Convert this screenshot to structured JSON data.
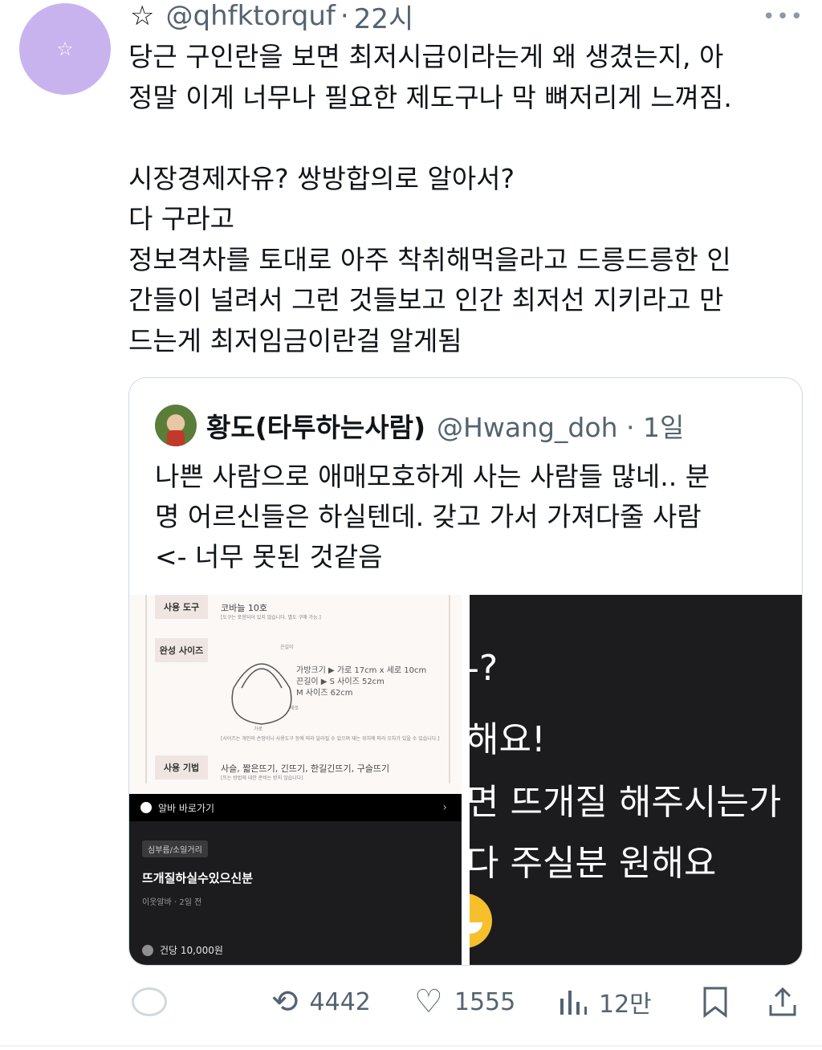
{
  "tweet": {
    "star": "☆",
    "handle": "@qhfktorquf",
    "time": "22시",
    "more": "•••",
    "text": "당근 구인란을 보면 최저시급이라는게 왜 생겼는지, 아\n정말 이게 너무나 필요한 제도구나 막 뼈저리게 느껴짐.\n\n시장경제자유? 쌍방합의로 알아서?\n다 구라고\n정보격차를 토대로 아주 착취해먹을라고 드릉드릉한 인\n간들이 널려서 그런 것들보고 인간 최저선 지키라고 만\n드는게 최저임금이란걸 알게됨"
  },
  "quote": {
    "name": "황도(타투하는사람)",
    "handle": "@Hwang_doh",
    "time": "1일",
    "text": "나쁜 사람으로 애매모호하게 사는 사람들 많네.. 분\n명 어르신들은 하실텐데. 갖고 가서 가져다줄 사람\n<- 너무 못된 것같음",
    "media_left": {
      "tool_label": "사용 도구",
      "tool_value": "코바늘 10호",
      "tool_note": "[도구는 포함되어 있지 않습니다. 별도 구매 가능.]",
      "size_label": "완성 사이즈",
      "strap_tag": "끈길이",
      "spec": "가방크기 ▶ 가로 17cm x 세로 10cm\n끈길이 ▶ S 사이즈 52cm\nM 사이즈 62cm",
      "width_tag": "가로",
      "height_tag": "세로",
      "disclaimer": "[사이즈는 개인의 손땀이나 사용도구 등에 따라 달라질 수 있으며 재는 위치에 따라 오차가 있을 수 있습니다.]",
      "method_label": "사용 기법",
      "method_value": "사슬, 짧은뜨기, 긴뜨기, 한길긴뜨기, 구슬뜨기",
      "method_note": "[뜨는 방법에 대한 준비는 받지 않습니다]",
      "alba_link": "알바 바로가기",
      "category": "심부름/소일거리",
      "job_title": "뜨개질하실수있으신분",
      "job_meta": "이웃알바 · 2일 전",
      "pay": "건당 10,000원"
    },
    "media_right": {
      "line1": "-?",
      "line2": "해요!",
      "line3": "면 뜨개질 해주시는가",
      "line4": "다 주실분 원해요"
    }
  },
  "actions": {
    "retweets": "4442",
    "likes": "1555",
    "views": "12만"
  },
  "colors": {
    "avatar": "#c9b3ee",
    "muted_text": "#536471",
    "border": "#cfd9de"
  }
}
